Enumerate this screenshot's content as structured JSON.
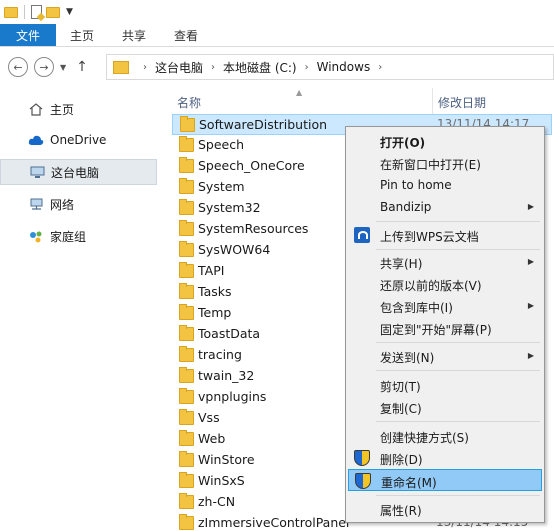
{
  "ribbon": {
    "tabs": [
      "文件",
      "主页",
      "共享",
      "查看"
    ]
  },
  "address": {
    "crumbs": [
      "这台电脑",
      "本地磁盘 (C:)",
      "Windows"
    ]
  },
  "navpane": {
    "items": [
      {
        "label": "主页",
        "icon": "home-icon"
      },
      {
        "label": "OneDrive",
        "icon": "cloud-icon"
      },
      {
        "label": "这台电脑",
        "icon": "computer-icon"
      },
      {
        "label": "网络",
        "icon": "network-icon"
      },
      {
        "label": "家庭组",
        "icon": "homegroup-icon"
      }
    ]
  },
  "list": {
    "col_name": "名称",
    "col_date": "修改日期",
    "rows": [
      {
        "name": "SoftwareDistribution",
        "date": "13/11/14 14:17"
      },
      {
        "name": "Speech",
        "date": ""
      },
      {
        "name": "Speech_OneCore",
        "date": ""
      },
      {
        "name": "System",
        "date": ""
      },
      {
        "name": "System32",
        "date": ""
      },
      {
        "name": "SystemResources",
        "date": ""
      },
      {
        "name": "SysWOW64",
        "date": ""
      },
      {
        "name": "TAPI",
        "date": ""
      },
      {
        "name": "Tasks",
        "date": ""
      },
      {
        "name": "Temp",
        "date": ""
      },
      {
        "name": "ToastData",
        "date": ""
      },
      {
        "name": "tracing",
        "date": ""
      },
      {
        "name": "twain_32",
        "date": ""
      },
      {
        "name": "vpnplugins",
        "date": ""
      },
      {
        "name": "Vss",
        "date": ""
      },
      {
        "name": "Web",
        "date": ""
      },
      {
        "name": "WinStore",
        "date": ""
      },
      {
        "name": "WinSxS",
        "date": ""
      },
      {
        "name": "zh-CN",
        "date": ""
      },
      {
        "name": "zImmersiveControlPanel",
        "date": "13/11/14 14:15"
      }
    ]
  },
  "menu": {
    "open": "打开(O)",
    "open_new_window": "在新窗口中打开(E)",
    "pin_home": "Pin to home",
    "bandizip": "Bandizip",
    "wps_upload": "上传到WPS云文档",
    "share": "共享(H)",
    "restore_versions": "还原以前的版本(V)",
    "include_library": "包含到库中(I)",
    "pin_start": "固定到\"开始\"屏幕(P)",
    "send_to": "发送到(N)",
    "cut": "剪切(T)",
    "copy": "复制(C)",
    "create_shortcut": "创建快捷方式(S)",
    "delete": "删除(D)",
    "rename": "重命名(M)",
    "properties": "属性(R)"
  },
  "colors": {
    "file_tab": "#1979ca",
    "selection": "#cce8ff",
    "menu_highlight": "#91c9f7"
  }
}
